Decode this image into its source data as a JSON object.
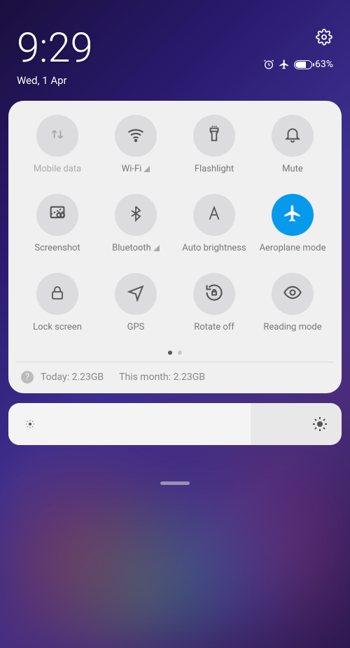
{
  "status": {
    "time": "9:29",
    "date": "Wed, 1 Apr",
    "battery_percent": "63%",
    "battery_level_pct": 63
  },
  "toggles": [
    {
      "id": "mobile-data",
      "label": "Mobile data",
      "icon": "arrows-updown",
      "active": false,
      "disabled": true,
      "indicator": false
    },
    {
      "id": "wifi",
      "label": "Wi-Fi",
      "icon": "wifi",
      "active": false,
      "disabled": false,
      "indicator": true
    },
    {
      "id": "flashlight",
      "label": "Flashlight",
      "icon": "flashlight",
      "active": false,
      "disabled": false,
      "indicator": false
    },
    {
      "id": "mute",
      "label": "Mute",
      "icon": "bell",
      "active": false,
      "disabled": false,
      "indicator": false
    },
    {
      "id": "screenshot",
      "label": "Screenshot",
      "icon": "screenshot",
      "active": false,
      "disabled": false,
      "indicator": false
    },
    {
      "id": "bluetooth",
      "label": "Bluetooth",
      "icon": "bluetooth",
      "active": false,
      "disabled": false,
      "indicator": true
    },
    {
      "id": "auto-brightness",
      "label": "Auto brightness",
      "icon": "auto-a",
      "active": false,
      "disabled": false,
      "indicator": false
    },
    {
      "id": "aeroplane-mode",
      "label": "Aeroplane mode",
      "icon": "plane",
      "active": true,
      "disabled": false,
      "indicator": false
    },
    {
      "id": "lock-screen",
      "label": "Lock screen",
      "icon": "lock",
      "active": false,
      "disabled": false,
      "indicator": false
    },
    {
      "id": "gps",
      "label": "GPS",
      "icon": "nav-arrow",
      "active": false,
      "disabled": false,
      "indicator": false
    },
    {
      "id": "rotate-off",
      "label": "Rotate off",
      "icon": "rotate-lock",
      "active": false,
      "disabled": false,
      "indicator": false
    },
    {
      "id": "reading-mode",
      "label": "Reading mode",
      "icon": "eye",
      "active": false,
      "disabled": false,
      "indicator": false
    }
  ],
  "pager": {
    "pages": 2,
    "current": 0
  },
  "usage": {
    "today_label": "Today:",
    "today_value": "2.23GB",
    "month_label": "This month:",
    "month_value": "2.23GB"
  },
  "brightness": {
    "level_pct": 73
  }
}
